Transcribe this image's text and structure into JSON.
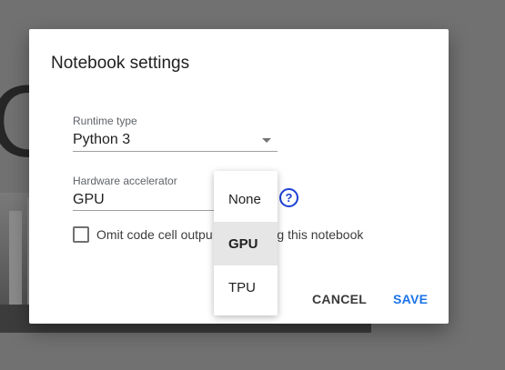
{
  "dialog": {
    "title": "Notebook settings",
    "runtime": {
      "label": "Runtime type",
      "value": "Python 3"
    },
    "hardware": {
      "label": "Hardware accelerator",
      "value": "GPU",
      "help_icon": "help-circle-icon"
    },
    "omit_output": {
      "label_before": "Omit code cell outpu",
      "label_after": "ng this notebook",
      "checked": false
    },
    "buttons": {
      "cancel": "CANCEL",
      "save": "SAVE"
    }
  },
  "dropdown": {
    "options": [
      "None",
      "GPU",
      "TPU"
    ],
    "selected": "GPU"
  },
  "background": {
    "heading_fragment": "C"
  },
  "colors": {
    "accent": "#1a73e8",
    "help": "#1a3fd6",
    "selected_bg": "#e6e6e6"
  }
}
